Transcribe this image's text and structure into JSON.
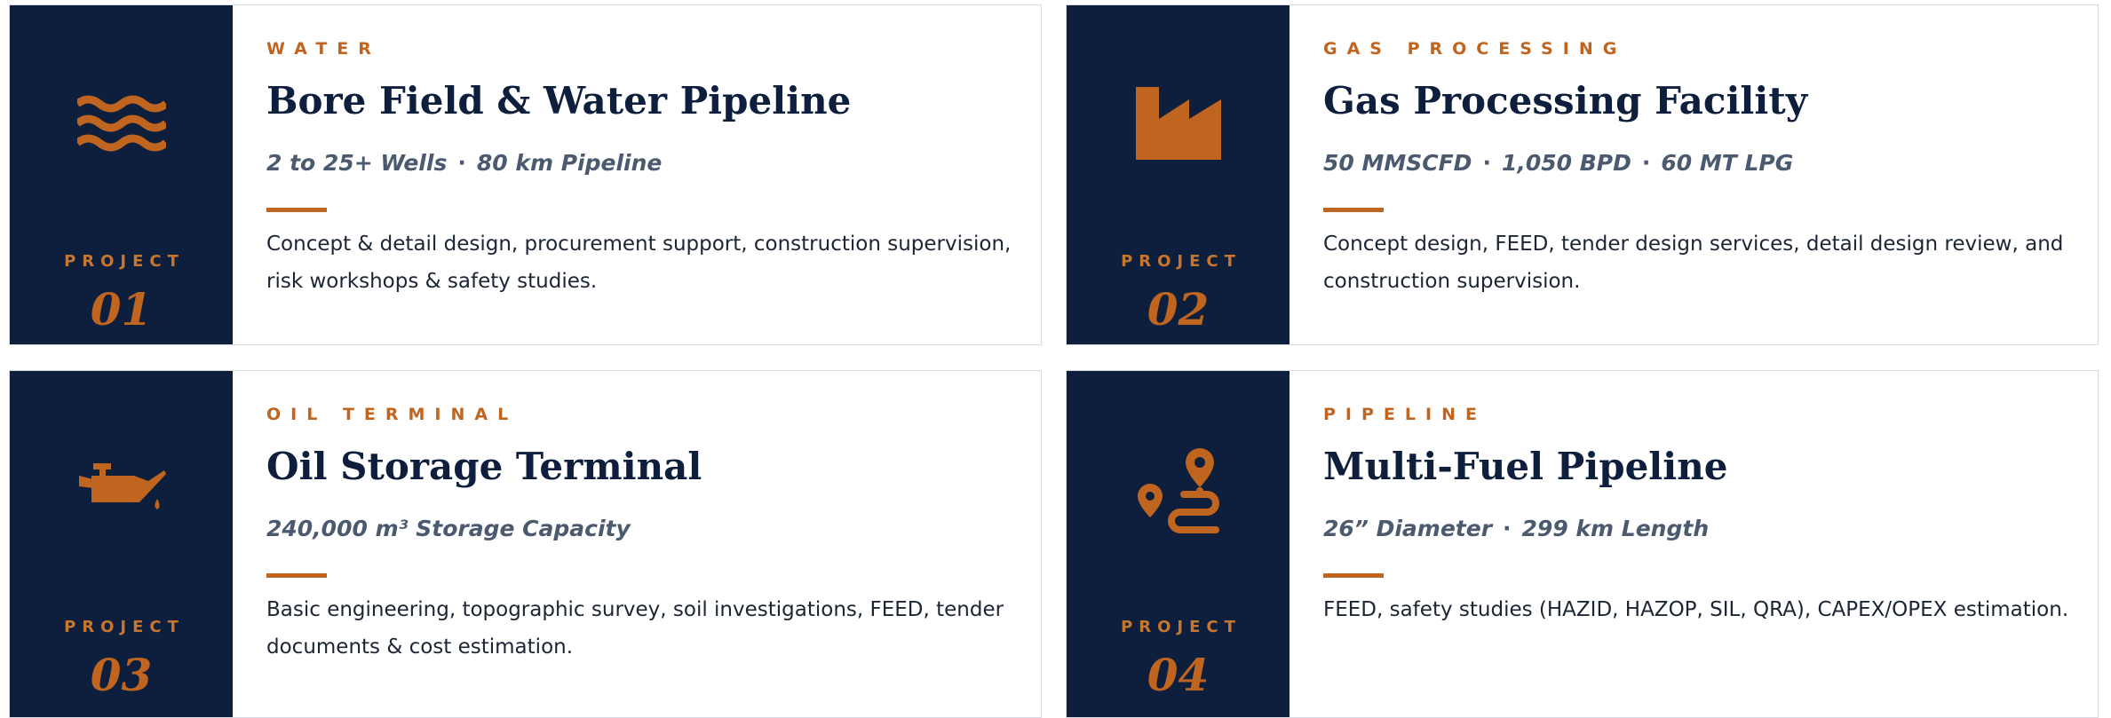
{
  "colors": {
    "navy": "#0d1f3c",
    "accent": "#c0651f",
    "muted": "#4b5a6e"
  },
  "projects": [
    {
      "icon": "water-waves-icon",
      "project_label": "PROJECT",
      "number": "01",
      "category": "WATER",
      "title": "Bore Field & Water Pipeline",
      "specs": [
        "2 to 25+ Wells",
        "80 km Pipeline"
      ],
      "description": "Concept & detail design, procurement support, construction supervision, risk workshops & safety studies."
    },
    {
      "icon": "factory-icon",
      "project_label": "PROJECT",
      "number": "02",
      "category": "GAS PROCESSING",
      "title": "Gas Processing Facility",
      "specs": [
        "50 MMSCFD",
        "1,050 BPD",
        "60 MT LPG"
      ],
      "description": "Concept design, FEED, tender design services, detail design review, and construction supervision."
    },
    {
      "icon": "oil-can-icon",
      "project_label": "PROJECT",
      "number": "03",
      "category": "OIL TERMINAL",
      "title": "Oil Storage Terminal",
      "specs": [
        "240,000 m³ Storage Capacity"
      ],
      "description": "Basic engineering, topographic survey, soil investigations, FEED, tender documents & cost estimation."
    },
    {
      "icon": "route-icon",
      "project_label": "PROJECT",
      "number": "04",
      "category": "PIPELINE",
      "title": "Multi-Fuel Pipeline",
      "specs": [
        "26” Diameter",
        "299 km Length"
      ],
      "description": "FEED, safety studies (HAZID, HAZOP, SIL, QRA), CAPEX/OPEX estimation."
    }
  ]
}
